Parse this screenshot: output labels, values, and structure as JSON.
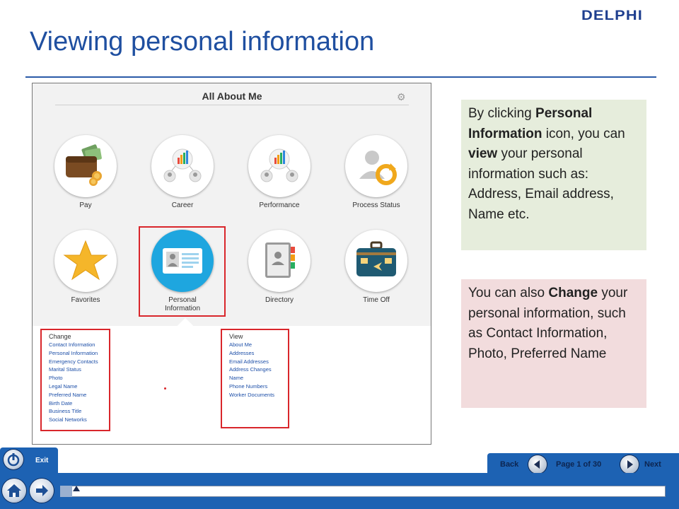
{
  "brand": {
    "logo_text": "DELPHI",
    "accent": "#1f4fa0",
    "highlight": "#d9262b"
  },
  "slide": {
    "title": "Viewing personal information"
  },
  "app": {
    "header": "All About Me",
    "tiles": [
      {
        "label": "Pay",
        "icon": "wallet-icon"
      },
      {
        "label": "Career",
        "icon": "career-chart-icon"
      },
      {
        "label": "Performance",
        "icon": "performance-chart-icon"
      },
      {
        "label": "Process Status",
        "icon": "process-status-icon"
      },
      {
        "label": "Favorites",
        "icon": "star-icon"
      },
      {
        "label_line1": "Personal",
        "label_line2": "Information",
        "icon": "id-card-icon"
      },
      {
        "label": "Directory",
        "icon": "address-book-icon"
      },
      {
        "label": "Time Off",
        "icon": "suitcase-icon"
      }
    ],
    "change": {
      "header": "Change",
      "links": [
        "Contact Information",
        "Personal Information",
        "Emergency Contacts",
        "Marital Status",
        "Photo",
        "Legal Name",
        "Preferred Name",
        "Birth Date",
        "Business Title",
        "Social Networks"
      ]
    },
    "view": {
      "header": "View",
      "links": [
        "About Me",
        "Addresses",
        "Email Addresses",
        "Address Changes",
        "Name",
        "Phone Numbers",
        "Worker Documents"
      ]
    }
  },
  "notes": {
    "green": {
      "t1": "By clicking ",
      "b1": "Personal Information",
      "t2": " icon, you can ",
      "b2": "view",
      "t3": " your personal information such as: Address, Email address, Name etc."
    },
    "pink": {
      "t1": "You can also ",
      "b1": "Change",
      "t2": " your personal information, such as Contact Information, Photo, Preferred Name"
    }
  },
  "player": {
    "exit_label": "Exit",
    "back_label": "Back",
    "page_label": "Page 1 of 30",
    "next_label": "Next",
    "progress": 0.02,
    "colors": {
      "bar": "#1d62b3",
      "label": "#0d2550"
    }
  }
}
